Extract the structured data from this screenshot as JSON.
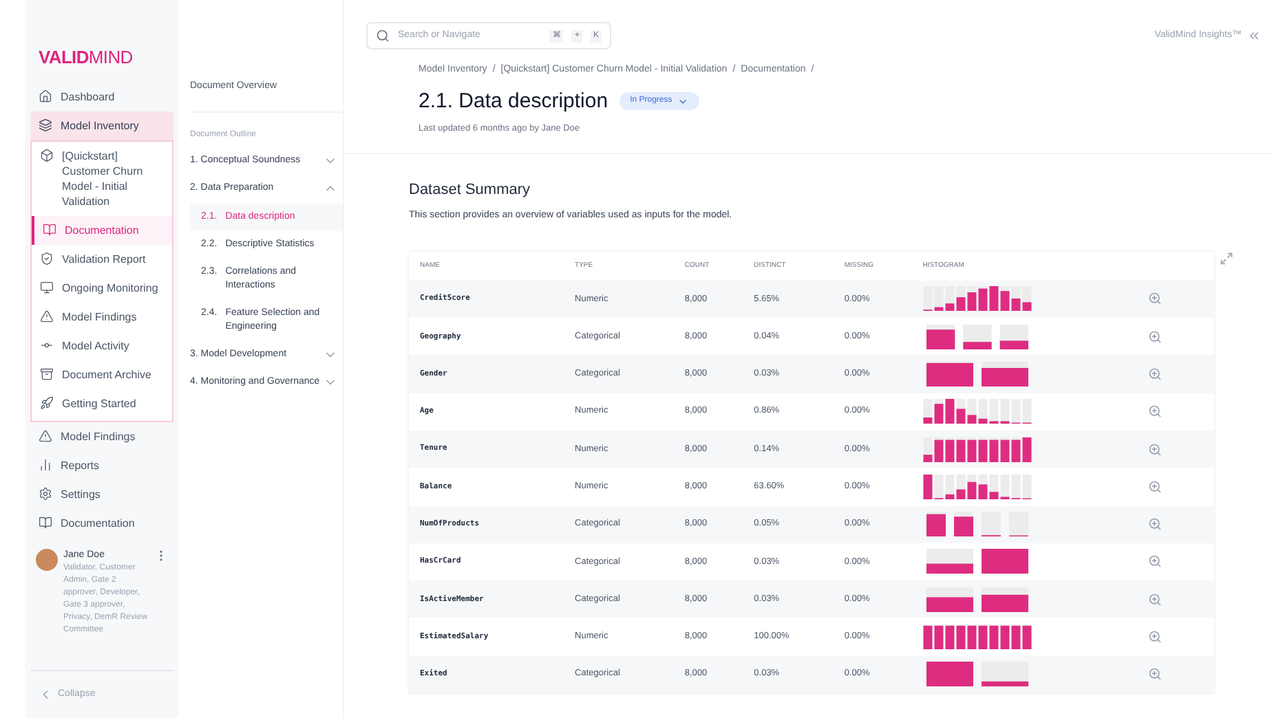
{
  "brand": {
    "logo_bold": "VALID",
    "logo_light": "MIND"
  },
  "sidebar": {
    "items": [
      {
        "label": "Dashboard",
        "selected": false
      },
      {
        "label": "Model Inventory",
        "selected": true,
        "children": [
          {
            "label": "[Quickstart] Customer Churn Model - Initial Validation",
            "selected": false
          },
          {
            "label": "Documentation",
            "selected": true
          },
          {
            "label": "Validation Report",
            "selected": false
          },
          {
            "label": "Ongoing Monitoring",
            "selected": false
          },
          {
            "label": "Model Findings",
            "selected": false
          },
          {
            "label": "Model Activity",
            "selected": false
          },
          {
            "label": "Document Archive",
            "selected": false
          },
          {
            "label": "Getting Started",
            "selected": false
          }
        ]
      },
      {
        "label": "Model Findings",
        "selected": false
      },
      {
        "label": "Reports",
        "selected": false
      },
      {
        "label": "Settings",
        "selected": false
      },
      {
        "label": "Documentation",
        "selected": false
      }
    ],
    "user": {
      "name": "Jane Doe",
      "roles": "Validator, Customer Admin, Gate 2 approver, Developer, Gate 3 approver, Privacy, DemR Review Committee"
    },
    "collapse": "Collapse"
  },
  "outline": {
    "overview": "Document Overview",
    "heading": "Document Outline",
    "sections": [
      {
        "label": "1. Conceptual Soundness",
        "expanded": false
      },
      {
        "label": "2. Data Preparation",
        "expanded": true,
        "children": [
          {
            "number": "2.1.",
            "label": "Data description",
            "selected": true
          },
          {
            "number": "2.2.",
            "label": "Descriptive Statistics",
            "selected": false
          },
          {
            "number": "2.3.",
            "label": "Correlations and Interactions",
            "selected": false
          },
          {
            "number": "2.4.",
            "label": "Feature Selection and Engineering",
            "selected": false
          }
        ]
      },
      {
        "label": "3. Model Development",
        "expanded": false
      },
      {
        "label": "4. Monitoring and Governance",
        "expanded": false
      }
    ]
  },
  "search": {
    "placeholder": "Search or Navigate",
    "keys": [
      "⌘",
      "+",
      "K"
    ]
  },
  "insights": "ValidMind Insights™",
  "breadcrumbs": [
    "Model Inventory",
    "[Quickstart] Customer Churn Model - Initial Validation",
    "Documentation"
  ],
  "breadcrumb_separator": "/",
  "page": {
    "title": "2.1. Data description",
    "status": "In Progress",
    "updated": "Last updated 6 months ago by Jane Doe"
  },
  "section": {
    "title": "Dataset Summary",
    "description": "This section provides an overview of variables used as inputs for the model."
  },
  "table": {
    "columns": [
      "NAME",
      "TYPE",
      "COUNT",
      "DISTINCT",
      "MISSING",
      "HISTOGRAM"
    ],
    "rows": [
      [
        "CreditScore",
        "Numeric",
        "8,000",
        "5.65%",
        "0.00%"
      ],
      [
        "Geography",
        "Categorical",
        "8,000",
        "0.04%",
        "0.00%"
      ],
      [
        "Gender",
        "Categorical",
        "8,000",
        "0.03%",
        "0.00%"
      ],
      [
        "Age",
        "Numeric",
        "8,000",
        "0.86%",
        "0.00%"
      ],
      [
        "Tenure",
        "Numeric",
        "8,000",
        "0.14%",
        "0.00%"
      ],
      [
        "Balance",
        "Numeric",
        "8,000",
        "63.60%",
        "0.00%"
      ],
      [
        "NumOfProducts",
        "Categorical",
        "8,000",
        "0.05%",
        "0.00%"
      ],
      [
        "HasCrCard",
        "Categorical",
        "8,000",
        "0.03%",
        "0.00%"
      ],
      [
        "IsActiveMember",
        "Categorical",
        "8,000",
        "0.03%",
        "0.00%"
      ],
      [
        "EstimatedSalary",
        "Numeric",
        "8,000",
        "100.00%",
        "0.00%"
      ],
      [
        "Exited",
        "Categorical",
        "8,000",
        "0.03%",
        "0.00%"
      ]
    ]
  }
}
